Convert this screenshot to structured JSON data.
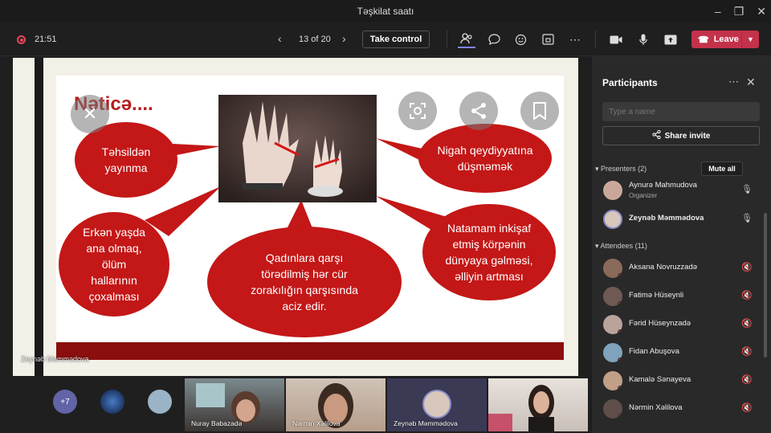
{
  "window": {
    "title": "Təşkilat saatı"
  },
  "toolbar": {
    "timer": "21:51",
    "page_indicator": "13 of 20",
    "take_control_label": "Take control",
    "leave_label": "Leave"
  },
  "slide": {
    "title": "Nəticə....",
    "bubble_1": "Təhsildən\nyayınma",
    "bubble_2": "Nigah qeydiyyatına\ndüşməmək",
    "bubble_3": "Erkən yaşda\nana olmaq,\nölüm\nhallarının\nçoxalması",
    "bubble_4": "Qadınlara qarşı\ntörədilmiş hər cür\nzorakılığın qarşısında\naciz edir.",
    "bubble_5": "Natamam inkişaf\netmiş körpənin\ndünyaya gəlməsi,\nəlliyin artması",
    "presenter_label": "Zeynəb Məmmədova"
  },
  "participants": {
    "title": "Participants",
    "search_placeholder": "Type a name",
    "share_invite_label": "Share invite",
    "presenters_header": "Presenters (2)",
    "mute_all_label": "Mute all",
    "attendees_header": "Attendees (11)",
    "presenters": [
      {
        "name": "Aynurə Mahmudova",
        "role": "Organizer"
      },
      {
        "name": "Zeynəb Məmmədova",
        "role": ""
      }
    ],
    "attendees": [
      {
        "name": "Aksana Novruzzadə"
      },
      {
        "name": "Fatimə Hüseynli"
      },
      {
        "name": "Fərid Hüseynzadə"
      },
      {
        "name": "Fidan Abuşova"
      },
      {
        "name": "Kamalə Sənayeva"
      },
      {
        "name": "Nərmin Xəlilova"
      }
    ]
  },
  "video_strip": {
    "overflow_count": "+7",
    "tiles": [
      {
        "name": "Nuray Babazadə"
      },
      {
        "name": "Nərmin Xəlilova"
      },
      {
        "name": "Zeynəb Məmmədova"
      },
      {
        "name": ""
      }
    ]
  },
  "colors": {
    "accent_red": "#c4314b",
    "slide_red": "#c41717"
  }
}
